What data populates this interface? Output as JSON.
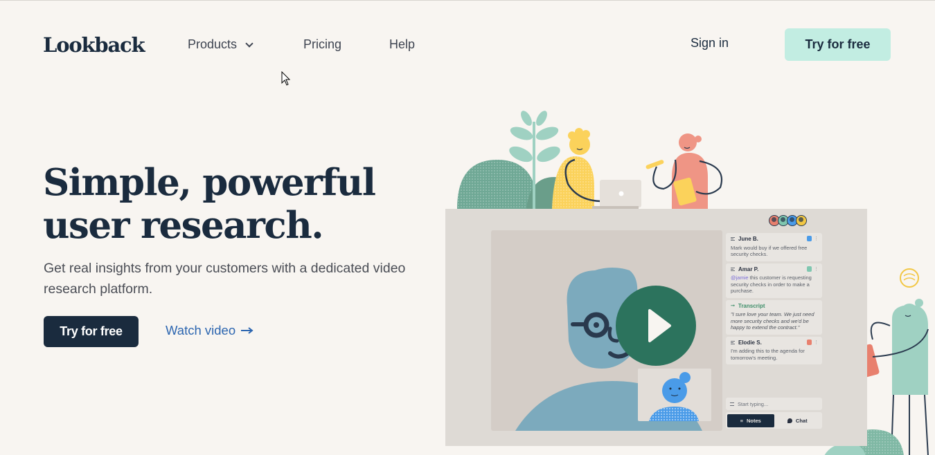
{
  "nav": {
    "logo": "Lookback",
    "links": [
      {
        "label": "Products",
        "has_dropdown": true
      },
      {
        "label": "Pricing"
      },
      {
        "label": "Help"
      }
    ],
    "sign_in": "Sign in",
    "cta": "Try for free"
  },
  "hero": {
    "title_line1": "Simple, powerful",
    "title_line2": "user research.",
    "subtitle": "Get real insights from your customers with a dedicated video research platform.",
    "cta_primary": "Try for free",
    "cta_secondary": "Watch video",
    "cta_secondary_icon": "arrow-right-icon"
  },
  "mockup": {
    "participant_colors": [
      "#e8806e",
      "#7fc7b0",
      "#4a9be8",
      "#f2c744"
    ],
    "notes": [
      {
        "author": "June B.",
        "text": "Mark would buy if we offered free security checks.",
        "icon_color": "#4a9be8"
      },
      {
        "author": "Amar P.",
        "mention": "@jamie",
        "text": " this customer is requesting security checks in order to make a purchase.",
        "icon_color": "#7fc7b0"
      },
      {
        "author": "Transcript",
        "type": "transcript",
        "text": "\"I sure love your team. We just need more security checks and we'd be happy to extend the contract.\""
      },
      {
        "author": "Elodie S.",
        "text": "I'm adding this to the agenda for tomorrow's meeting.",
        "icon_color": "#e8806e"
      }
    ],
    "input_placeholder": "Start typing...",
    "tabs": [
      {
        "label": "Notes",
        "active": true
      },
      {
        "label": "Chat",
        "active": false
      }
    ]
  },
  "colors": {
    "background": "#f8f5f1",
    "primary_dark": "#1a2b3e",
    "mint": "#c2ede2",
    "link_blue": "#2d66b0",
    "play_green": "#2c735d"
  }
}
